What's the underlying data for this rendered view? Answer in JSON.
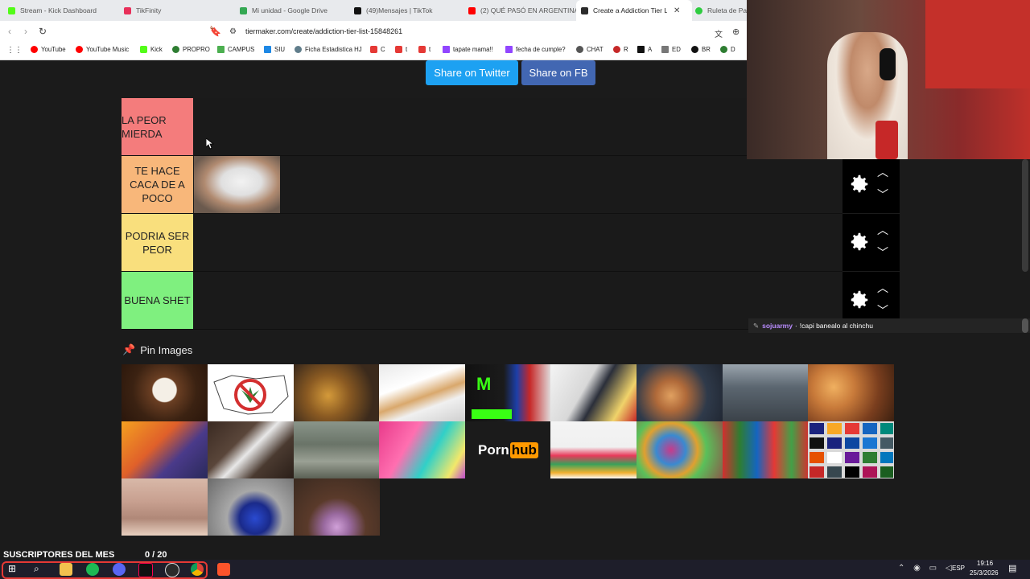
{
  "browser": {
    "tabs": [
      {
        "label": "Stream - Kick Dashboard",
        "color": "#53fc18"
      },
      {
        "label": "TikFinity",
        "color": "#e8305a"
      },
      {
        "label": "Mi unidad - Google Drive",
        "color": "#34a853"
      },
      {
        "label": "(49)Mensajes | TikTok",
        "color": "#111111"
      },
      {
        "label": "(2) QUÉ PASÓ EN ARGENTINA",
        "color": "#ff0000"
      },
      {
        "label": "Create a Addiction Tier Lis",
        "color": "#2b2b2b",
        "active": true
      },
      {
        "label": "Ruleta de Pal",
        "color": "#2ecc40"
      }
    ],
    "url": "tiermaker.com/create/addiction-tier-list-15848261",
    "bookmarks": [
      {
        "label": "YouTube",
        "color": "#ff0000"
      },
      {
        "label": "YouTube Music",
        "color": "#ff0000"
      },
      {
        "label": "Kick",
        "color": "#53fc18"
      },
      {
        "label": "PROPRO",
        "color": "#2e7d32"
      },
      {
        "label": "CAMPUS",
        "color": "#4caf50"
      },
      {
        "label": "SIU",
        "color": "#1e88e5"
      },
      {
        "label": "Ficha Estadistica HJ",
        "color": "#607d8b"
      },
      {
        "label": "C",
        "color": "#e53935"
      },
      {
        "label": "t",
        "color": "#e53935"
      },
      {
        "label": "t",
        "color": "#e53935"
      },
      {
        "label": "tapate mama!!",
        "color": "#9146ff"
      },
      {
        "label": "fecha de cumple?",
        "color": "#9146ff"
      },
      {
        "label": "CHAT",
        "color": "#555555"
      },
      {
        "label": "R",
        "color": "#c62828"
      },
      {
        "label": "A",
        "color": "#111111"
      },
      {
        "label": "ED",
        "color": "#777777"
      },
      {
        "label": "BR",
        "color": "#111111"
      },
      {
        "label": "D",
        "color": "#2e7d32"
      }
    ]
  },
  "share": {
    "twitter_label": "Share on Twitter",
    "fb_label": "Share on FB",
    "twitter_color": "#1da1f2",
    "fb_color": "#4267b2"
  },
  "tiers": [
    {
      "label": "LA PEOR MIERDA",
      "color": "#f47c7c"
    },
    {
      "label": "TE HACE CACA DE A POCO",
      "color": "#f8b77a"
    },
    {
      "label": "PODRIA SER PEOR",
      "color": "#f9df7d"
    },
    {
      "label": "BUENA SHET",
      "color": "#7ff07f"
    }
  ],
  "pin_images": {
    "title": "Pin Images",
    "items": [
      "coffee",
      "no-marijuana",
      "whiskey",
      "cigarettes",
      "energy-drinks",
      "casino-man",
      "pills-hand",
      "gym-weights",
      "donuts",
      "gamer",
      "cocaine-spoon",
      "hoarder-room",
      "vapes",
      "pornhub",
      "shopping-bags",
      "social-apps-pills",
      "sodas",
      "streaming-apps",
      "stomach",
      "nitrous-balloon",
      "lean-bottle"
    ],
    "pornhub_text_a": "Porn",
    "pornhub_text_b": "hub"
  },
  "chat": {
    "user": "sojuarmy",
    "message": "!capi banealo al chinchu"
  },
  "overlay": {
    "subs_label": "SUSCRIPTORES DEL MES",
    "subs_count": "0 / 20"
  },
  "taskbar": {
    "lang": "ESP",
    "time": "19:16",
    "date": "25/3/2026"
  }
}
